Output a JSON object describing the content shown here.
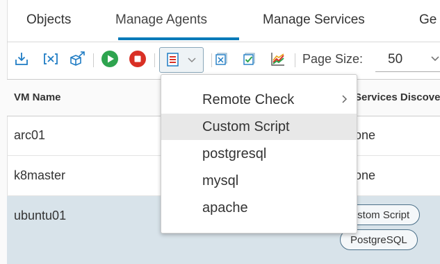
{
  "tabs": [
    {
      "label": "Objects"
    },
    {
      "label": "Manage Agents",
      "active": true
    },
    {
      "label": "Manage Services"
    },
    {
      "label": "Ge"
    }
  ],
  "toolbar": {
    "icons": [
      "download-agent-icon",
      "remove-agent-icon",
      "deploy-icon",
      "start-icon",
      "stop-icon",
      "script-menu-icon",
      "disable-service-icon",
      "enable-service-icon",
      "chart-icon"
    ],
    "page_size_label": "Page Size:",
    "page_size_value": "50"
  },
  "colors": {
    "accent": "#0079b8",
    "start": "#2ea44f",
    "stop": "#d93025",
    "icon_blue": "#1f7cc4"
  },
  "grid": {
    "columns": [
      "VM Name",
      "Services Discover"
    ],
    "rows": [
      {
        "vm_name": "arc01",
        "services": "one"
      },
      {
        "vm_name": "k8master",
        "services": "one"
      },
      {
        "vm_name": "ubuntu01",
        "services_tags": [
          "Custom Script",
          "PostgreSQL"
        ],
        "selected": true
      }
    ]
  },
  "menu": {
    "items": [
      {
        "label": "Remote Check",
        "has_submenu": true
      },
      {
        "label": "Custom Script",
        "hover": true
      },
      {
        "label": "postgresql"
      },
      {
        "label": "mysql"
      },
      {
        "label": "apache"
      }
    ]
  }
}
